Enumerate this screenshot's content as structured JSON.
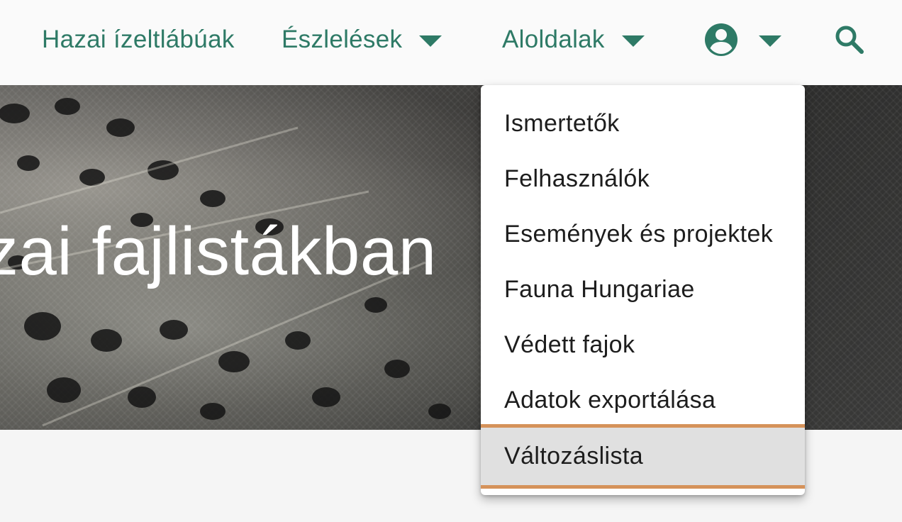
{
  "nav": {
    "home": "Hazai ízeltlábúak",
    "observations": "Észlelések",
    "subpages": "Aloldalak"
  },
  "hero": {
    "title": "zai fajlistákban"
  },
  "dropdown": {
    "items": [
      "Ismertetők",
      "Felhasználók",
      "Események és projektek",
      "Fauna Hungariae",
      "Védett fajok",
      "Adatok exportálása",
      "Változáslista"
    ],
    "active_index": 6
  },
  "colors": {
    "brand_green": "#2e7a66",
    "active_border": "#d5925a",
    "active_background": "#e0e0e0"
  },
  "icons": {
    "user": "account-circle-icon",
    "search": "search-icon",
    "dropdown": "chevron-down-icon"
  }
}
